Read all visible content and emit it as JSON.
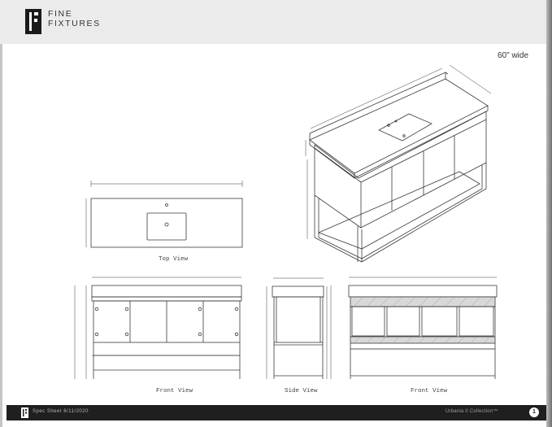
{
  "brand": {
    "name_line1": "FINE",
    "name_line2": "FIXTURES",
    "logo_icon": "ff-logo-icon"
  },
  "spec": {
    "width_label": "60\" wide"
  },
  "views": {
    "top": "Top View",
    "front1": "Front View",
    "side": "Side View",
    "front2": "Front View"
  },
  "footer": {
    "left": "Spec Sheet 6/11/2020",
    "right": "Urbania II Collection™",
    "page": "1"
  },
  "colors": {
    "header_bg": "#ebebeb",
    "footer_bg": "#1f1f1f",
    "line": "#3a3a3a"
  }
}
